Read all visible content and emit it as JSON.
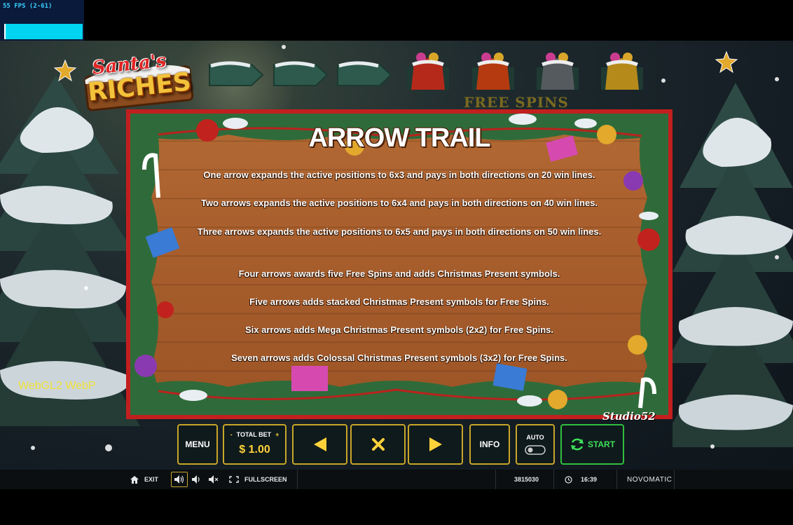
{
  "debug": {
    "fps_label": "55 FPS (2-61)"
  },
  "logo": {
    "line1": "Santa's",
    "line2": "RICHES"
  },
  "trail": {
    "free_spins_label": "FREE SPINS"
  },
  "panel": {
    "title": "ARROW TRAIL",
    "rules": [
      "One arrow expands the active positions to 6x3 and pays in both directions on 20 win lines.",
      "Two arrows expands the active positions to 6x4 and pays in both directions on 40 win lines.",
      "Three arrows expands the active positions to 6x5 and pays in both directions on 50 win lines.",
      "Four arrows awards five Free Spins and adds Christmas Present symbols.",
      "Five arrows adds stacked Christmas Present symbols for Free Spins.",
      "Six arrows adds Mega Christmas Present symbols (2x2) for Free Spins.",
      "Seven arrows adds Colossal Christmas Present symbols (3x2) for Free Spins."
    ],
    "studio": "Studio52"
  },
  "renderer_label": "WebGL2  WebP",
  "controls": {
    "menu": "MENU",
    "total_bet_label": "TOTAL BET",
    "bet_minus": "-",
    "bet_plus": "+",
    "total_bet_value": "$ 1.00",
    "prev_icon": "triangle-left",
    "close_icon": "x-mark",
    "next_icon": "triangle-right",
    "info": "INFO",
    "auto": "AUTO",
    "start": "START"
  },
  "bottom_bar": {
    "exit": "EXIT",
    "fullscreen": "FULLSCREEN",
    "session_id": "3815030",
    "time": "16:39",
    "brand": "NOVOMATIC"
  },
  "colors": {
    "panel_frame": "#c21f1f",
    "wood": "#a95f2d",
    "control_border": "#c8a628",
    "start_border": "#2fbf3f",
    "fps_bar": "#00d4f0"
  }
}
